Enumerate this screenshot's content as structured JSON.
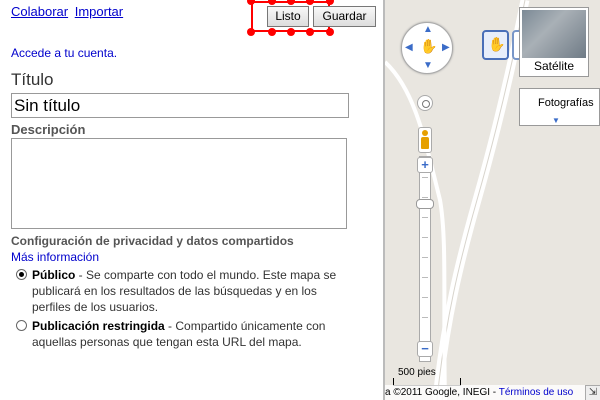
{
  "panel": {
    "links": [
      "Colaborar",
      "Importar"
    ],
    "done_label": "Listo",
    "save_label": "Guardar",
    "signin_text": "Accede a tu cuenta.",
    "title_label": "Título",
    "title_value": "Sin título",
    "description_label": "Descripción",
    "description_value": "",
    "privacy_title": "Configuración de privacidad y datos compartidos",
    "more_info": "Más información",
    "public_label": "Público",
    "public_text": " - Se comparte con todo el mundo. Este mapa se publicará en los resultados de las búsquedas y en los perfiles de los usuarios.",
    "restricted_label": "Publicación restringida",
    "restricted_text": " - Compartido únicamente con aquellas personas que tengan esta URL del mapa.",
    "selected_privacy": "public"
  },
  "map": {
    "satellite_label": "Satélite",
    "photos_label": "Fotografías",
    "scale_label": "500 pies",
    "attribution": "a ©2011 Google, INEGI - ",
    "terms_label": "Términos de uso",
    "zoom_in": "+",
    "zoom_out": "−",
    "colors": {
      "road": "#ffffff",
      "land": "#e9e6e0",
      "control": "#3b6cc8",
      "selection": "#ff0000"
    }
  }
}
